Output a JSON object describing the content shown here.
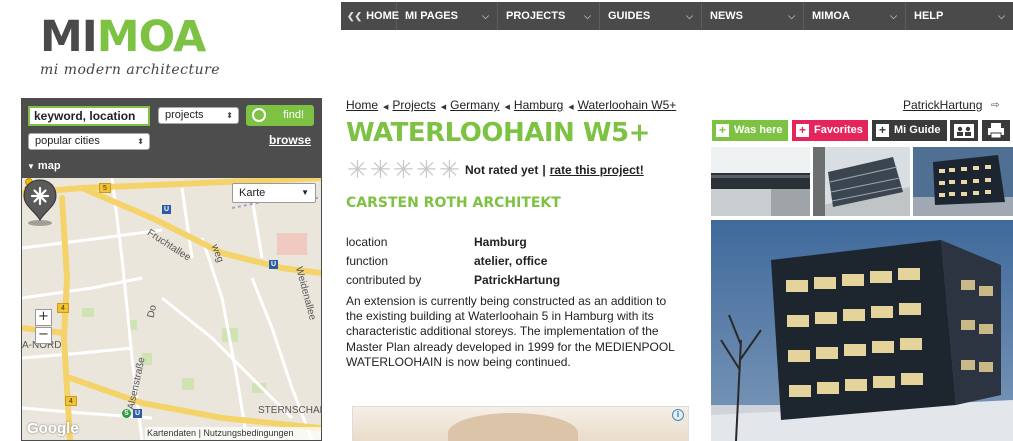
{
  "logo": {
    "mi": "MI",
    "moa": "MOA",
    "tagline": "mi modern architecture",
    "brand_green": "#7dc242",
    "brand_gray": "#4a4a4a"
  },
  "nav": {
    "home": "HOME",
    "items": [
      "MI PAGES",
      "PROJECTS",
      "GUIDES",
      "NEWS",
      "MIMOA",
      "HELP"
    ]
  },
  "search": {
    "keyword_value": "keyword, location",
    "type_select": "projects",
    "city_select": "popular cities",
    "find_label": "find!",
    "browse_label": "browse",
    "map_toggle": "map"
  },
  "map": {
    "type_select": "Karte",
    "zoom_in": "+",
    "zoom_out": "−",
    "brand": "Google",
    "attribution_data": "Kartendaten",
    "attribution_sep": "|",
    "attribution_terms": "Nutzungsbedingungen",
    "streets": {
      "fruchtallee": "Fruchtallee",
      "weidenallee": "Weidenallee",
      "alsenstrasse": "Alsenstraße",
      "nord": "A-NORD",
      "sternschanze": "STERNSCHAN",
      "weg": "weg",
      "do": "Do"
    },
    "road_numbers": [
      "5",
      "4",
      "4"
    ],
    "station_letter": "U",
    "s_letter": "S"
  },
  "breadcrumb": [
    "Home",
    "Projects",
    "Germany",
    "Hamburg",
    "Waterloohain W5+"
  ],
  "project": {
    "title": "WATERLOOHAIN W5+",
    "rating_text": "Not rated yet",
    "rating_sep": "|",
    "rate_link": "rate this project!",
    "architect": "CARSTEN ROTH ARCHITEKT",
    "info": [
      {
        "key": "location",
        "value": "Hamburg"
      },
      {
        "key": "function",
        "value": "atelier, office"
      },
      {
        "key": "contributed by",
        "value": "PatrickHartung"
      }
    ],
    "description": "An extension is currently being constructed as an addition to the existing building at Waterloohain 5 in Hamburg with its characteristic additional storeys. The implementation of the Master Plan already developed in 1999 for the MEDIENPOOL WATERLOOHAIN is now being continued."
  },
  "user": {
    "name": "PatrickHartung"
  },
  "actions": {
    "was_here": "Was here",
    "favorites": "Favorites",
    "mi_guide": "Mi Guide",
    "fav_color": "#e4245a",
    "dark_color": "#3a3a3a"
  },
  "ad": {
    "badge": "i"
  }
}
